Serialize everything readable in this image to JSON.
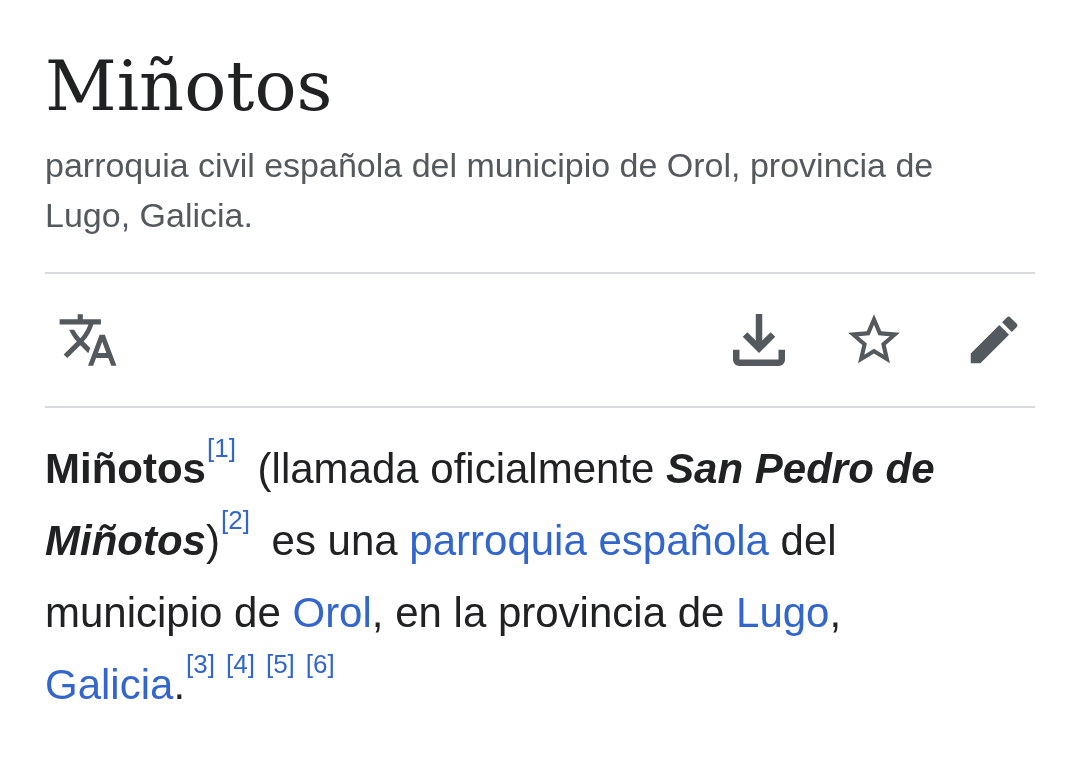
{
  "title": "Miñotos",
  "description": "parroquia civil española del municipio de Orol, provincia de Lugo, Galicia.",
  "actions": [
    {
      "kind": "language"
    },
    {
      "kind": "download"
    },
    {
      "kind": "watch",
      "on": false
    },
    {
      "kind": "edit"
    }
  ],
  "paragraph": [
    {
      "kind": "bold",
      "text": "Miñotos"
    },
    {
      "kind": "ref",
      "text": "[1]"
    },
    {
      "kind": "text",
      "text": " (llamada oficialmente "
    },
    {
      "kind": "bold_italic",
      "text": "San Pedro de Miñotos"
    },
    {
      "kind": "text",
      "text": ")"
    },
    {
      "kind": "ref",
      "text": "[2]"
    },
    {
      "kind": "text",
      "text": " es una "
    },
    {
      "kind": "link",
      "text": "parroquia española"
    },
    {
      "kind": "text",
      "text": " del municipio de "
    },
    {
      "kind": "link",
      "text": "Orol"
    },
    {
      "kind": "text",
      "text": ", en la provincia de "
    },
    {
      "kind": "link",
      "text": "Lugo"
    },
    {
      "kind": "text",
      "text": ", "
    },
    {
      "kind": "link",
      "text": "Galicia"
    },
    {
      "kind": "text",
      "text": "."
    },
    {
      "kind": "ref",
      "text": "[3]"
    },
    {
      "kind": "ref",
      "text": "[4]"
    },
    {
      "kind": "ref",
      "text": "[5]"
    },
    {
      "kind": "ref",
      "text": "[6]"
    }
  ]
}
